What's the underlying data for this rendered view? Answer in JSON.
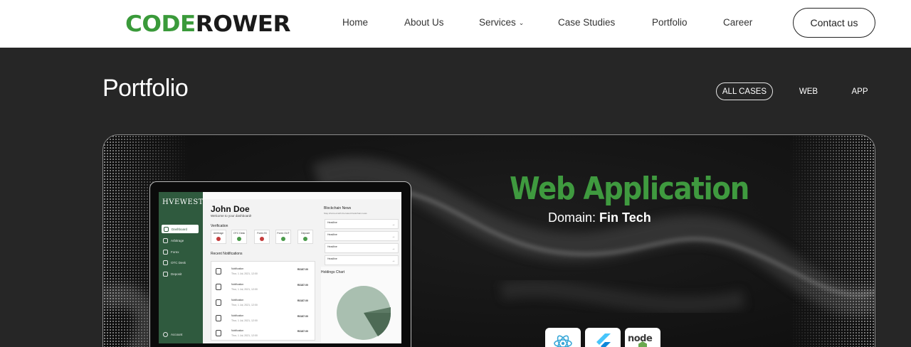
{
  "nav": {
    "logo_part1": "CODE",
    "logo_part2": "ROWER",
    "items": [
      {
        "label": "Home"
      },
      {
        "label": "About Us"
      },
      {
        "label": "Services",
        "dropdown": true
      },
      {
        "label": "Case Studies"
      },
      {
        "label": "Portfolio"
      },
      {
        "label": "Career"
      }
    ],
    "contact_label": "Contact us"
  },
  "page": {
    "title": "Portfolio",
    "filters": [
      {
        "label": "ALL CASES",
        "active": true
      },
      {
        "label": "WEB",
        "active": false
      },
      {
        "label": "APP",
        "active": false
      }
    ]
  },
  "case": {
    "title": "Web Application",
    "domain_label": "Domain:",
    "domain_value": "Fin Tech",
    "tech_icons": [
      "react-icon",
      "flutter-icon",
      "nodejs-icon"
    ],
    "tech_node_text": "node"
  },
  "mockup": {
    "brand": "HVEWEST",
    "sidebar": [
      "Dashboard",
      "Arbitrage",
      "Forex",
      "OTC Desk",
      "Deposit"
    ],
    "account": "Account",
    "user_name": "John Doe",
    "welcome": "Welcome to your dashboard!",
    "verification_heading": "Verification",
    "verification": [
      {
        "label": "Arbitrage",
        "ok": false
      },
      {
        "label": "OTC Desk",
        "ok": true
      },
      {
        "label": "Forex IN",
        "ok": false
      },
      {
        "label": "Forex OUT",
        "ok": true
      },
      {
        "label": "Deposit",
        "ok": true
      }
    ],
    "notifications_heading": "Recent Notifications",
    "notification_title": "Notification",
    "notification_date": "Thur, 1 Jul, 2021, 12:00",
    "notification_amount": "R3187.00",
    "news_heading": "Blockchain News",
    "news_sub": "Stay informed with the latest blockchain news",
    "headline": "Headline",
    "holdings_heading": "Holdings Chart"
  },
  "colors": {
    "brand_green": "#3a9a3a",
    "dark_bg": "#262626",
    "mock_sidebar": "#2f5a3e"
  }
}
